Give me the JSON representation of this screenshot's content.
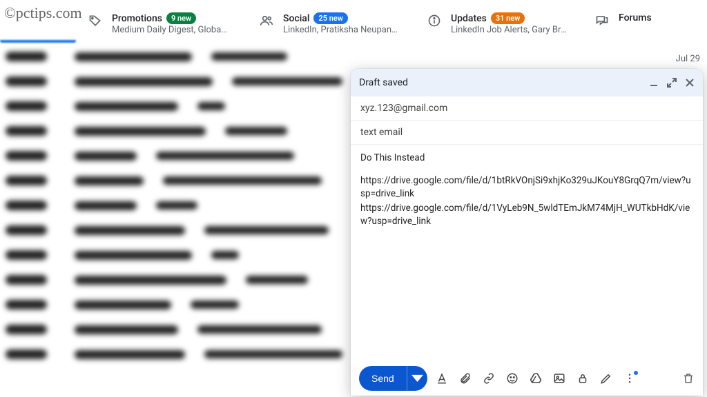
{
  "watermark": "©pctips.com",
  "tabs": {
    "promotions": {
      "label": "Promotions",
      "badge": "9 new",
      "sub": "Medium Daily Digest, GlobalS…"
    },
    "social": {
      "label": "Social",
      "badge": "25 new",
      "sub": "LinkedIn, Pratiksha Neupane, …"
    },
    "updates": {
      "label": "Updates",
      "badge": "31 new",
      "sub": "LinkedIn Job Alerts, Gary Bre…"
    },
    "forums": {
      "label": "Forums"
    }
  },
  "date_visible": "Jul 29",
  "compose": {
    "status": "Draft saved",
    "to": "xyz.123@gmail.com",
    "subject": "text email",
    "body_line1": "Do This Instead",
    "body_line2": "https://drive.google.com/file/d/1btRkVOnjSi9xhjKo329uJKouY8GrqQ7m/view?usp=drive_link",
    "body_line3": "https://drive.google.com/file/d/1VyLeb9N_5wldTEmJkM74MjH_WUTkbHdK/view?usp=drive_link",
    "send_label": "Send"
  }
}
